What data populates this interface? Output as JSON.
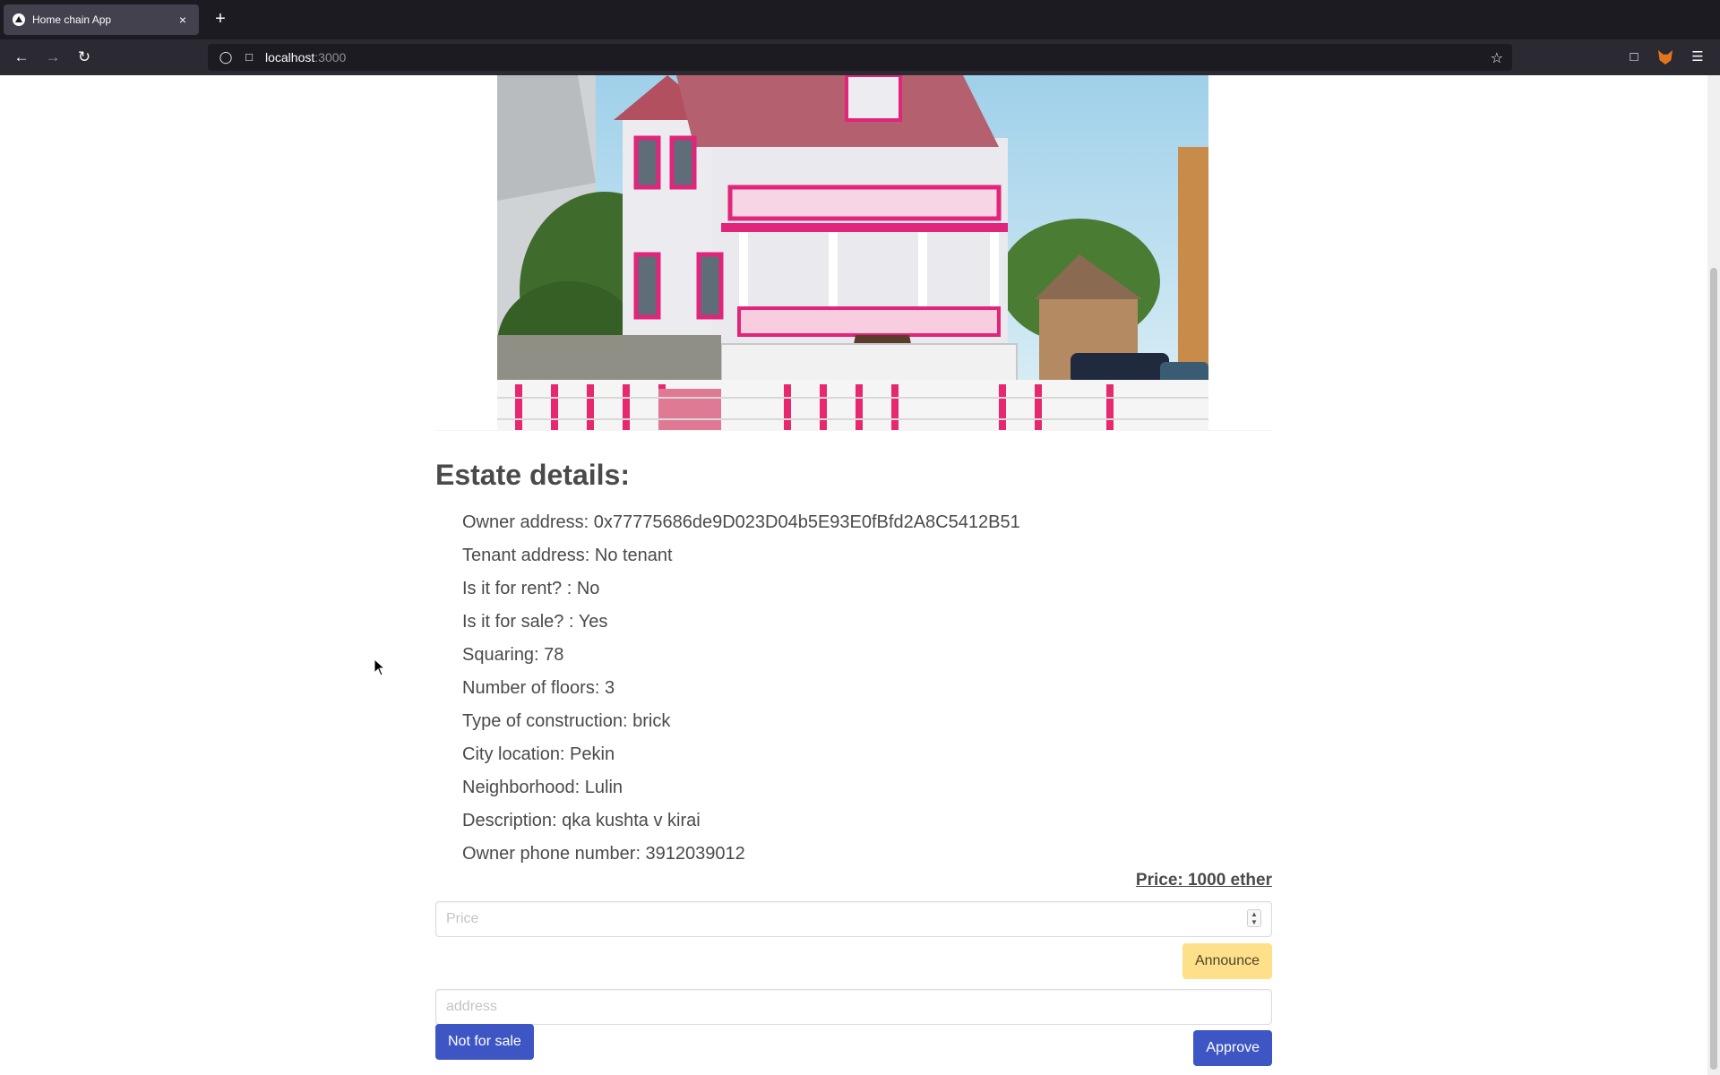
{
  "browser": {
    "tab_title": "Home chain App",
    "tab_close": "×",
    "new_tab": "+",
    "url_host": "localhost",
    "url_port": ":3000"
  },
  "page": {
    "heading": "Estate details:",
    "details": [
      "Owner address: 0x77775686de9D023D04b5E93E0fBfd2A8C5412B51",
      "Tenant address: No tenant",
      "Is it for rent? : No",
      "Is it for sale? : Yes",
      "Squaring: 78",
      "Number of floors: 3",
      "Type of construction: brick",
      "City location: Pekin",
      "Neighborhood: Lulin",
      "Description: qka kushta v kirai",
      "Owner phone number: 3912039012"
    ],
    "price_label": "Price: 1000 ether",
    "price_placeholder": "Price",
    "announce_label": "Announce",
    "address_placeholder": "address",
    "not_for_sale_label": "Not for sale",
    "approve_label": "Approve"
  },
  "colors": {
    "primary": "#3e56c4",
    "warning": "#ffe08a",
    "text": "#4a4a4a"
  }
}
